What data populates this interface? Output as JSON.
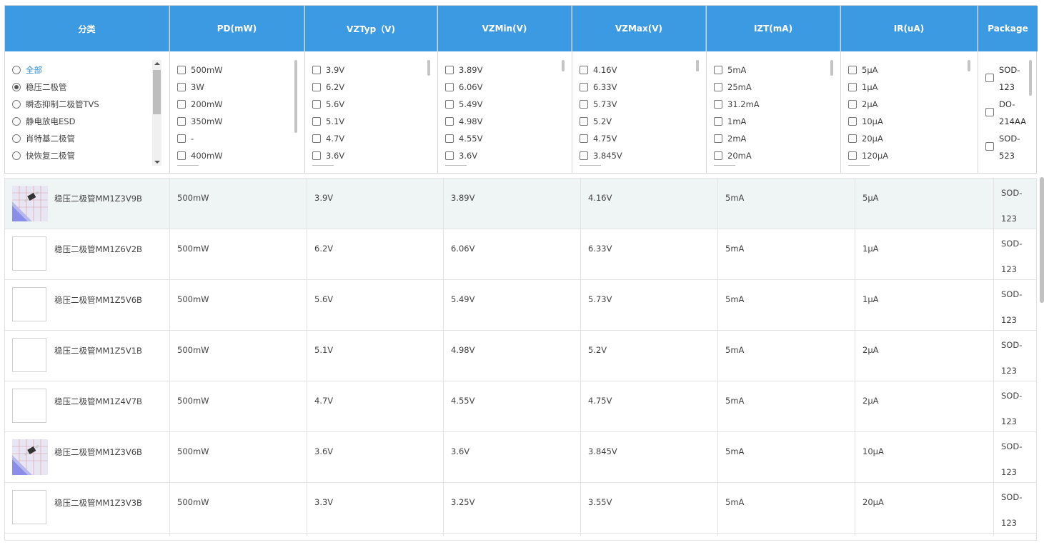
{
  "filters": {
    "category": {
      "header": "分类",
      "options": [
        {
          "label": "全部",
          "selected": false,
          "active": true
        },
        {
          "label": "稳压二极管",
          "selected": true,
          "active": false
        },
        {
          "label": "瞬态抑制二极管TVS",
          "selected": false,
          "active": false
        },
        {
          "label": "静电放电ESD",
          "selected": false,
          "active": false
        },
        {
          "label": "肖特基二极管",
          "selected": false,
          "active": false
        },
        {
          "label": "快恢复二极管",
          "selected": false,
          "active": false
        }
      ]
    },
    "pd": {
      "header": "PD(mW)",
      "options": [
        "500mW",
        "3W",
        "200mW",
        "350mW",
        "-",
        "400mW"
      ]
    },
    "vztyp": {
      "header": "VZTyp（V)",
      "options": [
        "3.9V",
        "6.2V",
        "5.6V",
        "5.1V",
        "4.7V",
        "3.6V"
      ]
    },
    "vzmin": {
      "header": "VZMin(V)",
      "options": [
        "3.89V",
        "6.06V",
        "5.49V",
        "4.98V",
        "4.55V",
        "3.6V"
      ]
    },
    "vzmax": {
      "header": "VZMax(V)",
      "options": [
        "4.16V",
        "6.33V",
        "5.73V",
        "5.2V",
        "4.75V",
        "3.845V"
      ]
    },
    "izt": {
      "header": "IZT(mA)",
      "options": [
        "5mA",
        "25mA",
        "31.2mA",
        "1mA",
        "2mA",
        "20mA"
      ]
    },
    "ir": {
      "header": "IR(uA)",
      "options": [
        "5μA",
        "1μA",
        "2μA",
        "10μA",
        "20μA",
        "120μA"
      ]
    },
    "package": {
      "header": "Package",
      "options": [
        [
          "SOD-",
          "123"
        ],
        [
          "DO-",
          "214AA"
        ],
        [
          "SOD-",
          "523"
        ]
      ]
    }
  },
  "products": [
    {
      "name": "稳压二极管MM1Z3V9B",
      "pd": "500mW",
      "vztyp": "3.9V",
      "vzmin": "3.89V",
      "vzmax": "4.16V",
      "izt": "5mA",
      "ir": "5μA",
      "pkg": [
        "SOD-",
        "123"
      ],
      "image": true,
      "highlight": true
    },
    {
      "name": "稳压二极管MM1Z6V2B",
      "pd": "500mW",
      "vztyp": "6.2V",
      "vzmin": "6.06V",
      "vzmax": "6.33V",
      "izt": "5mA",
      "ir": "1μA",
      "pkg": [
        "SOD-",
        "123"
      ],
      "image": false,
      "highlight": false
    },
    {
      "name": "稳压二极管MM1Z5V6B",
      "pd": "500mW",
      "vztyp": "5.6V",
      "vzmin": "5.49V",
      "vzmax": "5.73V",
      "izt": "5mA",
      "ir": "1μA",
      "pkg": [
        "SOD-",
        "123"
      ],
      "image": false,
      "highlight": false
    },
    {
      "name": "稳压二极管MM1Z5V1B",
      "pd": "500mW",
      "vztyp": "5.1V",
      "vzmin": "4.98V",
      "vzmax": "5.2V",
      "izt": "5mA",
      "ir": "2μA",
      "pkg": [
        "SOD-",
        "123"
      ],
      "image": false,
      "highlight": false
    },
    {
      "name": "稳压二极管MM1Z4V7B",
      "pd": "500mW",
      "vztyp": "4.7V",
      "vzmin": "4.55V",
      "vzmax": "4.75V",
      "izt": "5mA",
      "ir": "2μA",
      "pkg": [
        "SOD-",
        "123"
      ],
      "image": false,
      "highlight": false
    },
    {
      "name": "稳压二极管MM1Z3V6B",
      "pd": "500mW",
      "vztyp": "3.6V",
      "vzmin": "3.6V",
      "vzmax": "3.845V",
      "izt": "5mA",
      "ir": "10μA",
      "pkg": [
        "SOD-",
        "123"
      ],
      "image": true,
      "highlight": false
    },
    {
      "name": "稳压二极管MM1Z3V3B",
      "pd": "500mW",
      "vztyp": "3.3V",
      "vzmin": "3.25V",
      "vzmax": "3.55V",
      "izt": "5mA",
      "ir": "20μA",
      "pkg": [
        "SOD-",
        "123"
      ],
      "image": false,
      "highlight": false
    }
  ],
  "colors": {
    "header_bg": "#3c9ae2",
    "highlight_row": "#eff4f4",
    "active_link": "#2a8bd6"
  }
}
